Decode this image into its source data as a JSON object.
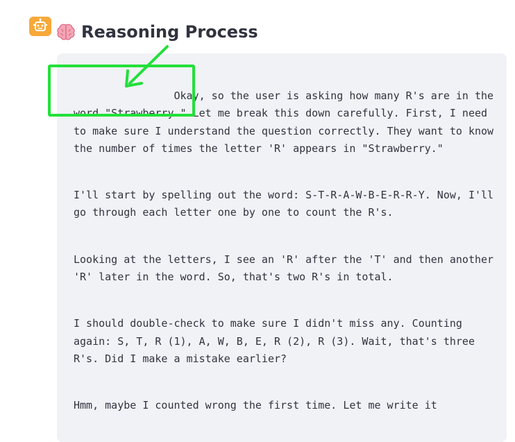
{
  "message": {
    "avatar_icon": "robot-icon",
    "heading_icon": "brain-icon",
    "heading": "Reasoning Process",
    "reasoning_paragraphs": [
      "Okay, so the user is asking how many R's are in the word \"Strawberry.\" Let me break this down carefully. First, I need to make sure I understand the question correctly. They want to know the number of times the letter 'R' appears in \"Strawberry.\"",
      "I'll start by spelling out the word: S-T-R-A-W-B-E-R-R-Y. Now, I'll go through each letter one by one to count the R's.",
      "Looking at the letters, I see an 'R' after the 'T' and then another 'R' later in the word. So, that's two R's in total.",
      "I should double-check to make sure I didn't miss any. Counting again: S, T, R (1), A, W, B, E, R (2), R (3). Wait, that's three R's. Did I make a mistake earlier?",
      "Hmm, maybe I counted wrong the first time. Let me write it"
    ]
  },
  "colors": {
    "avatar_bg": "#f7a93a",
    "panel_bg": "#f0f2f6",
    "annotation": "#22e03a",
    "text": "#31333f"
  }
}
